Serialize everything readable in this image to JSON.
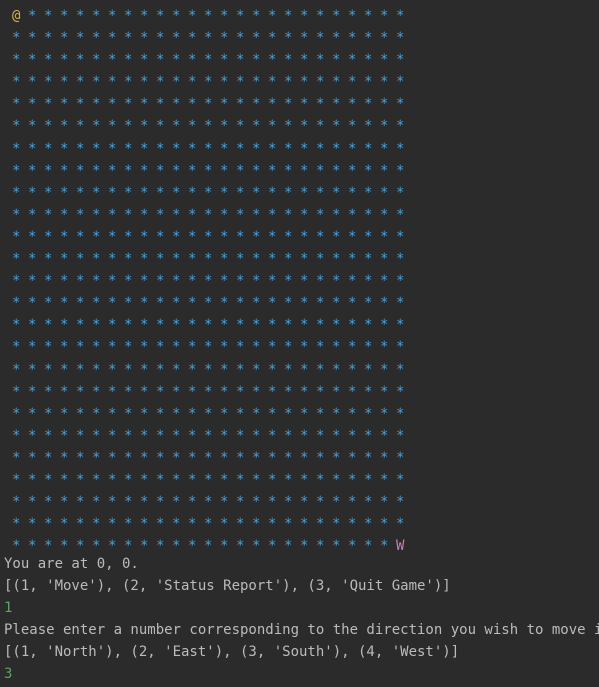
{
  "colors": {
    "background": "#2b2b2b",
    "grid_star": "#4a9fd6",
    "player_marker": "#d8b43c",
    "wumpus_marker": "#c77dbb",
    "output_text": "#bbbbbb",
    "user_input": "#5ea35e"
  },
  "grid": {
    "rows": [
      "@************************",
      "*************************",
      "*************************",
      "*************************",
      "*************************",
      "*************************",
      "*************************",
      "*************************",
      "*************************",
      "*************************",
      "*************************",
      "*************************",
      "*************************",
      "*************************",
      "*************************",
      "*************************",
      "*************************",
      "*************************",
      "*************************",
      "*************************",
      "*************************",
      "*************************",
      "*************************",
      "*************************",
      "************************W"
    ]
  },
  "console": {
    "lines": [
      {
        "text": "You are at 0, 0.",
        "kind": "output"
      },
      {
        "text": "[(1, 'Move'), (2, 'Status Report'), (3, 'Quit Game')]",
        "kind": "output"
      },
      {
        "text": "1",
        "kind": "input"
      },
      {
        "text": "Please enter a number corresponding to the direction you wish to move in.",
        "kind": "output"
      },
      {
        "text": "[(1, 'North'), (2, 'East'), (3, 'South'), (4, 'West')]",
        "kind": "output"
      },
      {
        "text": "3",
        "kind": "input"
      }
    ]
  }
}
